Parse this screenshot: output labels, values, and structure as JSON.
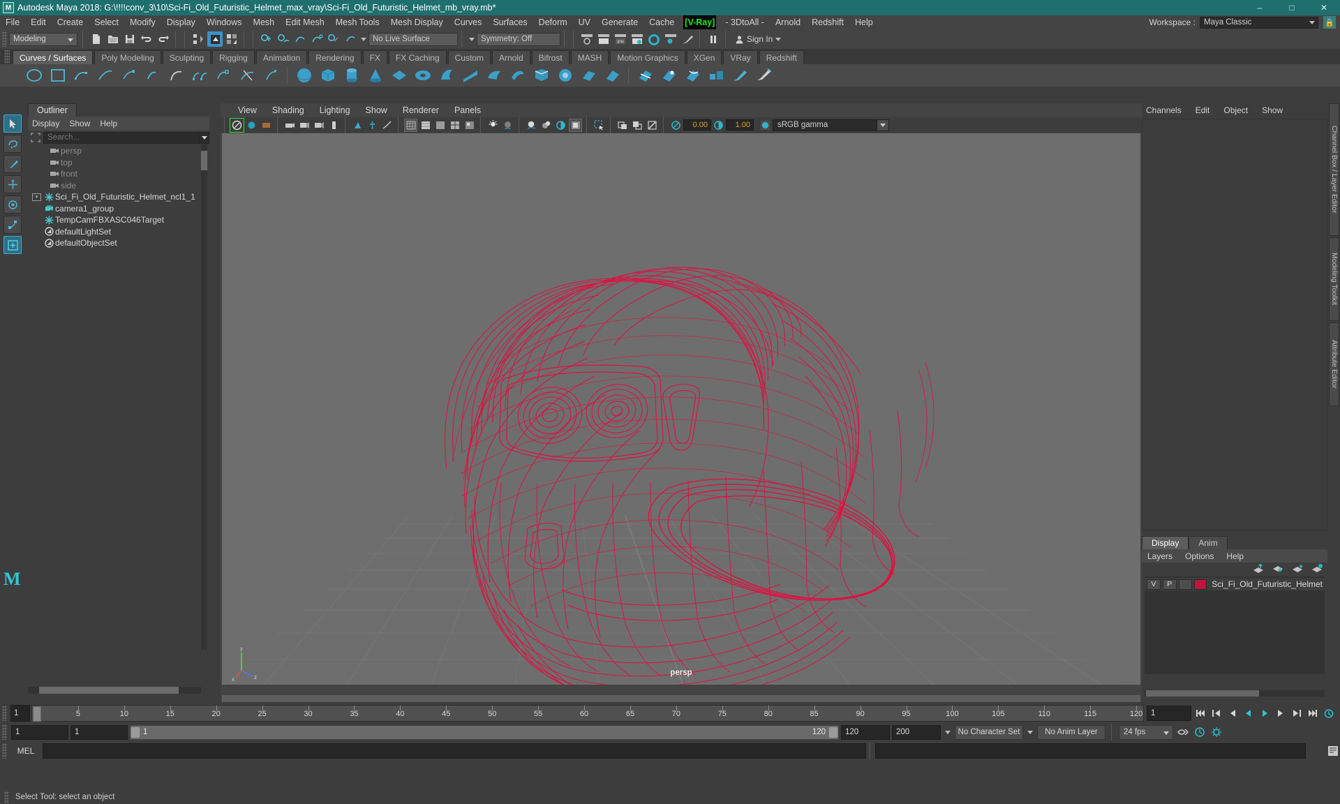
{
  "window": {
    "title": "Autodesk Maya 2018: G:\\!!!!conv_3\\10\\Sci-Fi_Old_Futuristic_Helmet_max_vray\\Sci-Fi_Old_Futuristic_Helmet_mb_vray.mb*",
    "app_icon": "maya-m-icon",
    "titlebar_color": "#1f6f6f",
    "minimize": "–",
    "maximize": "□",
    "close": "✕"
  },
  "menubar": {
    "items": [
      "File",
      "Edit",
      "Create",
      "Select",
      "Modify",
      "Display",
      "Windows",
      "Mesh",
      "Edit Mesh",
      "Mesh Tools",
      "Mesh Display",
      "Curves",
      "Surfaces",
      "Deform",
      "UV",
      "Generate",
      "Cache"
    ],
    "vray": "V-Ray",
    "vray_bracket_left": "[",
    "vray_bracket_right": "]",
    "vray_color": "#22ee22",
    "after_vray": [
      "- 3DtoAll -",
      "Arnold",
      "Redshift",
      "Help"
    ],
    "workspace_label": "Workspace :",
    "workspace_value": "Maya Classic"
  },
  "statusline": {
    "mode": "Modeling",
    "live_surface": "No Live Surface",
    "symmetry": "Symmetry: Off",
    "sign_in": "Sign In"
  },
  "shelf": {
    "tabs": [
      "Curves / Surfaces",
      "Poly Modeling",
      "Sculpting",
      "Rigging",
      "Animation",
      "Rendering",
      "FX",
      "FX Caching",
      "Custom",
      "Arnold",
      "Bifrost",
      "MASH",
      "Motion Graphics",
      "XGen",
      "VRay",
      "Redshift"
    ],
    "active_tab": "Curves / Surfaces"
  },
  "outliner": {
    "tab": "Outliner",
    "menus": [
      "Display",
      "Show",
      "Help"
    ],
    "search_placeholder": "Search...",
    "items": [
      {
        "label": "persp",
        "icon": "camera-icon",
        "dim": true,
        "expandable": false
      },
      {
        "label": "top",
        "icon": "camera-icon",
        "dim": true,
        "expandable": false
      },
      {
        "label": "front",
        "icon": "camera-icon",
        "dim": true,
        "expandable": false
      },
      {
        "label": "side",
        "icon": "camera-icon",
        "dim": true,
        "expandable": false
      },
      {
        "label": "Sci_Fi_Old_Futuristic_Helmet_ncl1_1",
        "icon": "transform-star-icon",
        "dim": false,
        "expandable": true
      },
      {
        "label": "camera1_group",
        "icon": "camera-group-icon",
        "dim": false,
        "expandable": false
      },
      {
        "label": "TempCamFBXASC046Target",
        "icon": "transform-star-icon",
        "dim": false,
        "expandable": false
      },
      {
        "label": "defaultLightSet",
        "icon": "set-icon",
        "dim": false,
        "expandable": false
      },
      {
        "label": "defaultObjectSet",
        "icon": "set-icon",
        "dim": false,
        "expandable": false
      }
    ]
  },
  "viewport": {
    "menus": [
      "View",
      "Shading",
      "Lighting",
      "Show",
      "Renderer",
      "Panels"
    ],
    "exposure_value": "0.00",
    "gamma_value": "1.00",
    "color_management": "sRGB gamma",
    "camera_label": "persp",
    "background_color": "#6e6e6e",
    "wireframe_color": "#e01040",
    "axis_x": "x",
    "axis_y": "y",
    "axis_z": "z"
  },
  "right_dock": {
    "channel_tabs": [
      "Channels",
      "Edit",
      "Object",
      "Show"
    ],
    "vertical_tabs": [
      "Channel Box / Layer Editor",
      "Modeling Toolkit",
      "Attribute Editor"
    ],
    "layer_editor": {
      "tabs": [
        "Display",
        "Anim"
      ],
      "active_tab": "Display",
      "menus": [
        "Layers",
        "Options",
        "Help"
      ],
      "layers": [
        {
          "visibility": "V",
          "playback": "P",
          "color": "#c1123c",
          "name": "Sci_Fi_Old_Futuristic_Helmet"
        }
      ]
    }
  },
  "time_slider": {
    "current_frame": "1",
    "ticks": [
      "5",
      "10",
      "15",
      "20",
      "25",
      "30",
      "35",
      "40",
      "45",
      "50",
      "55",
      "60",
      "65",
      "70",
      "75",
      "80",
      "85",
      "90",
      "95",
      "100",
      "105",
      "110",
      "115",
      "120"
    ],
    "start": 1,
    "end": 120,
    "end_field": "1"
  },
  "range_slider": {
    "anim_start": "1",
    "range_start": "1",
    "slider_start_label": "1",
    "slider_end_label": "120",
    "range_end": "120",
    "anim_end": "200",
    "character_set": "No Character Set",
    "anim_layer": "No Anim Layer",
    "fps": "24 fps"
  },
  "command_line": {
    "label": "MEL",
    "value": "",
    "placeholder": ""
  },
  "help_line": {
    "message": "Select Tool: select an object"
  }
}
